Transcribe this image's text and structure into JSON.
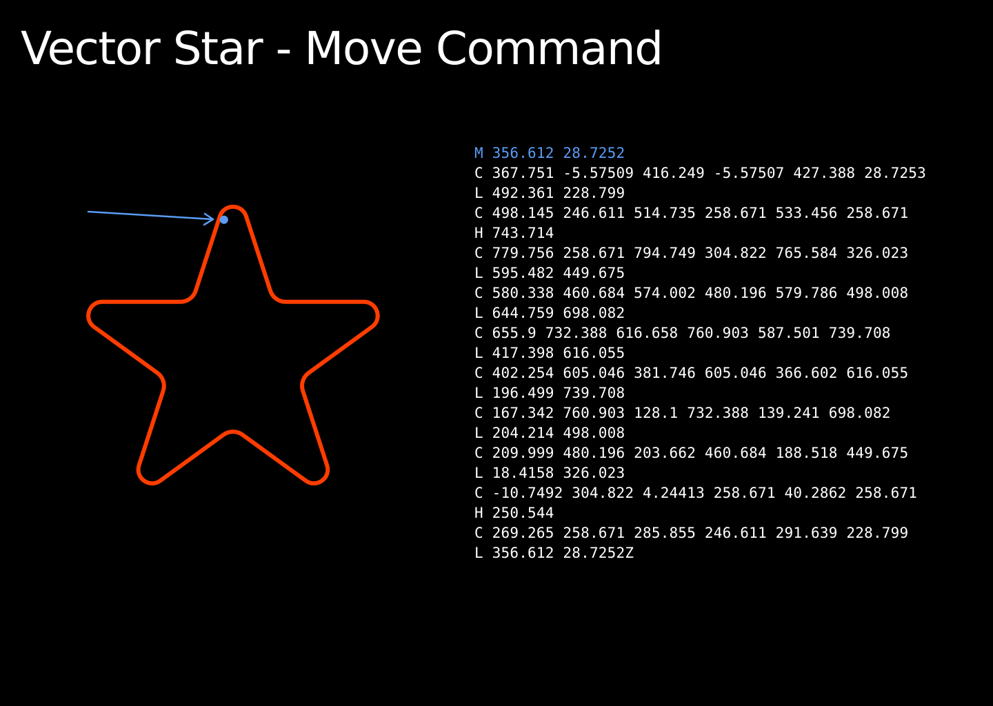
{
  "title": "Vector Star - Move Command",
  "colors": {
    "background": "#000000",
    "text": "#ffffff",
    "highlight": "#5b9cf5",
    "star_stroke": "#ff3d00"
  },
  "path_commands": [
    "M 356.612 28.7252",
    "C 367.751 -5.57509 416.249 -5.57507 427.388 28.7253",
    "L 492.361 228.799",
    "C 498.145 246.611 514.735 258.671 533.456 258.671",
    "H 743.714",
    "C 779.756 258.671 794.749 304.822 765.584 326.023",
    "L 595.482 449.675",
    "C 580.338 460.684 574.002 480.196 579.786 498.008",
    "L 644.759 698.082",
    "C 655.9 732.388 616.658 760.903 587.501 739.708",
    "L 417.398 616.055",
    "C 402.254 605.046 381.746 605.046 366.602 616.055",
    "L 196.499 739.708",
    "C 167.342 760.903 128.1 732.388 139.241 698.082",
    "L 204.214 498.008",
    "C 209.999 480.196 203.662 460.684 188.518 449.675",
    "L 18.4158 326.023",
    "C -10.7492 304.822 4.24413 258.671 40.2862 258.671",
    "H 250.544",
    "C 269.265 258.671 285.855 246.611 291.639 228.799",
    "L 356.612 28.7252Z"
  ],
  "highlighted_command_index": 0
}
